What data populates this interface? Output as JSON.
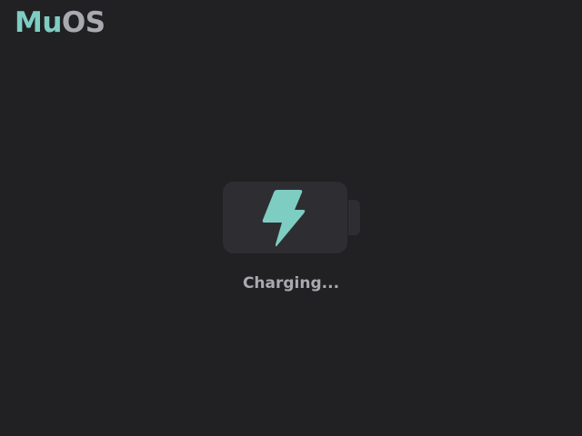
{
  "logo": {
    "mu": "Mu",
    "os": "OS"
  },
  "status": {
    "text": "Charging..."
  },
  "icons": {
    "battery": "battery-icon",
    "charging": "lightning-bolt-icon"
  },
  "colors": {
    "background": "#212123",
    "accent": "#7ecdc3",
    "text": "#a9a9b0",
    "battery": "#2e2e32"
  }
}
